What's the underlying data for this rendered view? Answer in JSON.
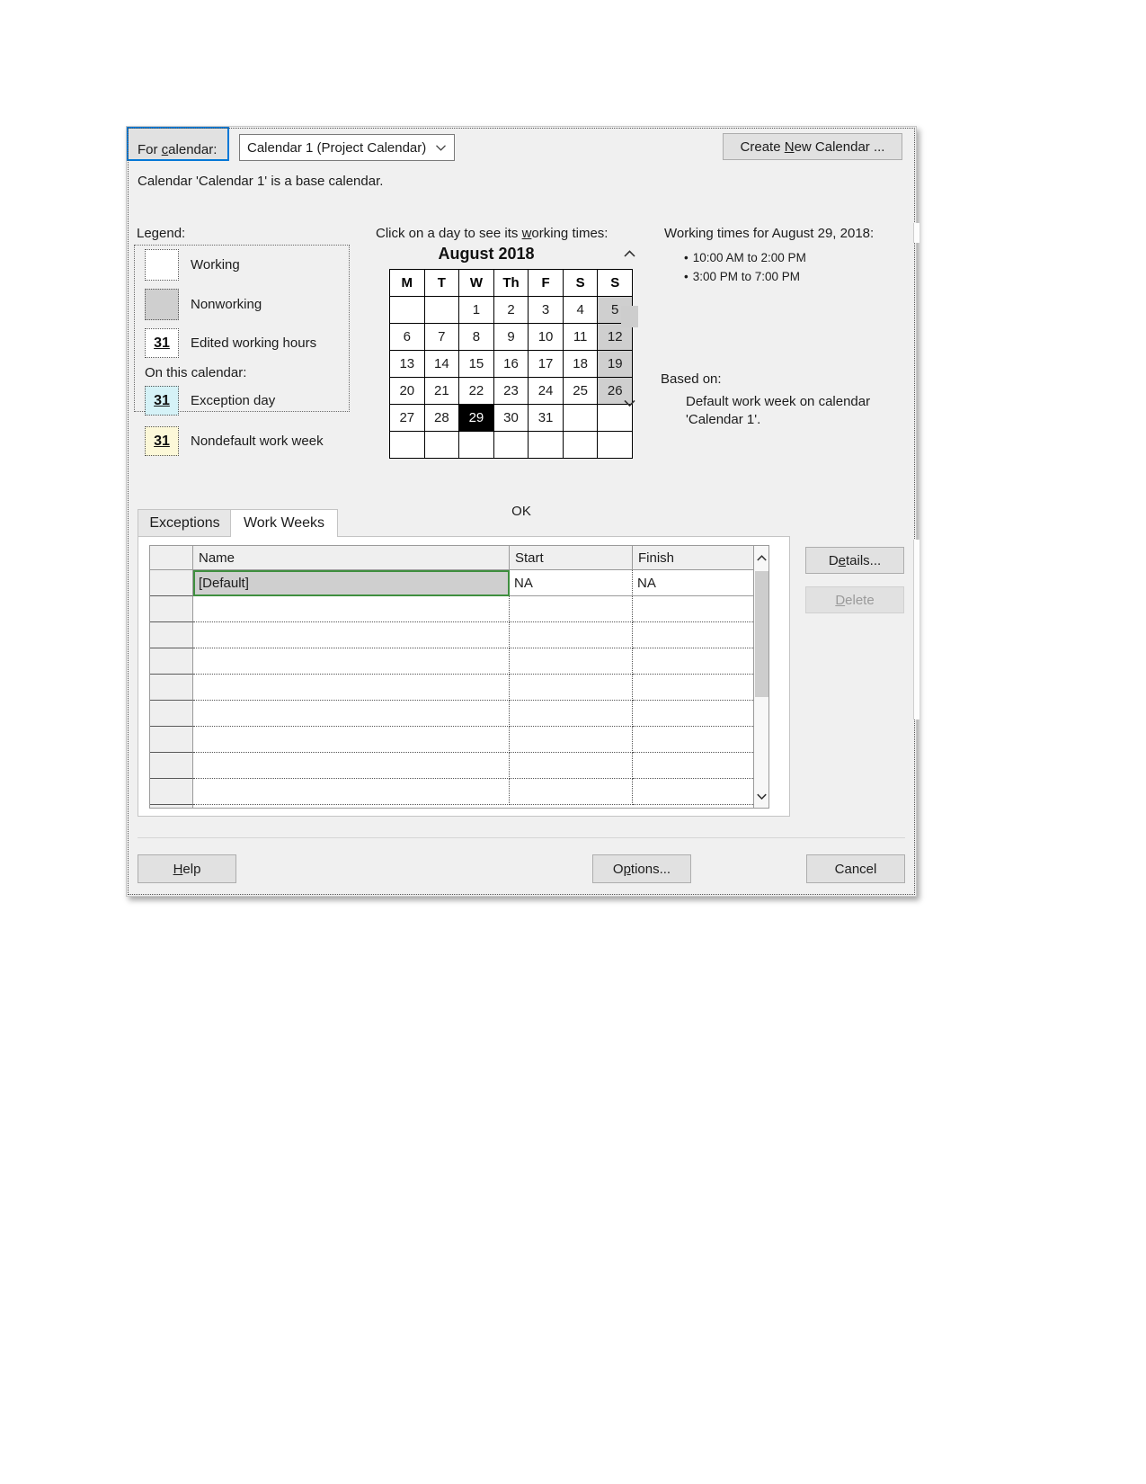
{
  "header": {
    "for_calendar_label": "For calendar:",
    "calendar_selected": "Calendar 1 (Project Calendar)",
    "base_note": "Calendar 'Calendar 1' is a base calendar.",
    "create_button": "Create New Calendar ..."
  },
  "legend": {
    "title": "Legend:",
    "subtitle": "On this calendar:",
    "items": [
      {
        "label": "Working",
        "swatch": "white",
        "glyph": ""
      },
      {
        "label": "Nonworking",
        "swatch": "gray",
        "glyph": ""
      },
      {
        "label": "Edited working hours",
        "swatch": "white",
        "glyph": "31"
      },
      {
        "label": "Exception day",
        "swatch": "cyan",
        "glyph": "31"
      },
      {
        "label": "Nondefault work week",
        "swatch": "yellow",
        "glyph": "31"
      }
    ],
    "colors": {
      "nonworking": "#cfcfcf",
      "exception": "#d5f2f7",
      "nondefault": "#fcf8d8"
    }
  },
  "calendar": {
    "hint": "Click on a day to see its working times:",
    "month_title": "August 2018",
    "day_headers": [
      "M",
      "T",
      "W",
      "Th",
      "F",
      "S",
      "S"
    ],
    "weeks": [
      [
        "",
        "",
        "1",
        "2",
        "3",
        "4",
        "5"
      ],
      [
        "6",
        "7",
        "8",
        "9",
        "10",
        "11",
        "12"
      ],
      [
        "13",
        "14",
        "15",
        "16",
        "17",
        "18",
        "19"
      ],
      [
        "20",
        "21",
        "22",
        "23",
        "24",
        "25",
        "26"
      ],
      [
        "27",
        "28",
        "29",
        "30",
        "31",
        "",
        ""
      ],
      [
        "",
        "",
        "",
        "",
        "",
        "",
        ""
      ]
    ],
    "nonworking_cells": [
      "0-6",
      "1-6",
      "2-6",
      "3-6"
    ],
    "selected_cell": "4-2"
  },
  "working_times": {
    "title": "Working times for August 29, 2018:",
    "entries": [
      "10:00 AM to 2:00 PM",
      "3:00 PM to 7:00 PM"
    ],
    "based_on_label": "Based on:",
    "based_on_line1": "Default work week on calendar",
    "based_on_line2": "'Calendar 1'."
  },
  "tabs": [
    {
      "label": "Exceptions",
      "active": false
    },
    {
      "label": "Work Weeks",
      "active": true
    }
  ],
  "table": {
    "columns": [
      "Name",
      "Start",
      "Finish"
    ],
    "rows": [
      {
        "name": "[Default]",
        "start": "NA",
        "finish": "NA",
        "selected": true
      },
      {
        "name": "",
        "start": "",
        "finish": "",
        "selected": false
      },
      {
        "name": "",
        "start": "",
        "finish": "",
        "selected": false
      },
      {
        "name": "",
        "start": "",
        "finish": "",
        "selected": false
      },
      {
        "name": "",
        "start": "",
        "finish": "",
        "selected": false
      },
      {
        "name": "",
        "start": "",
        "finish": "",
        "selected": false
      },
      {
        "name": "",
        "start": "",
        "finish": "",
        "selected": false
      },
      {
        "name": "",
        "start": "",
        "finish": "",
        "selected": false
      },
      {
        "name": "",
        "start": "",
        "finish": "",
        "selected": false
      }
    ],
    "selection_color": "#3f8f3f"
  },
  "side_buttons": {
    "details": "Details...",
    "delete": "Delete"
  },
  "footer": {
    "help": "Help",
    "options": "Options...",
    "ok": "OK",
    "cancel": "Cancel",
    "ok_accent": "#0078d7"
  }
}
